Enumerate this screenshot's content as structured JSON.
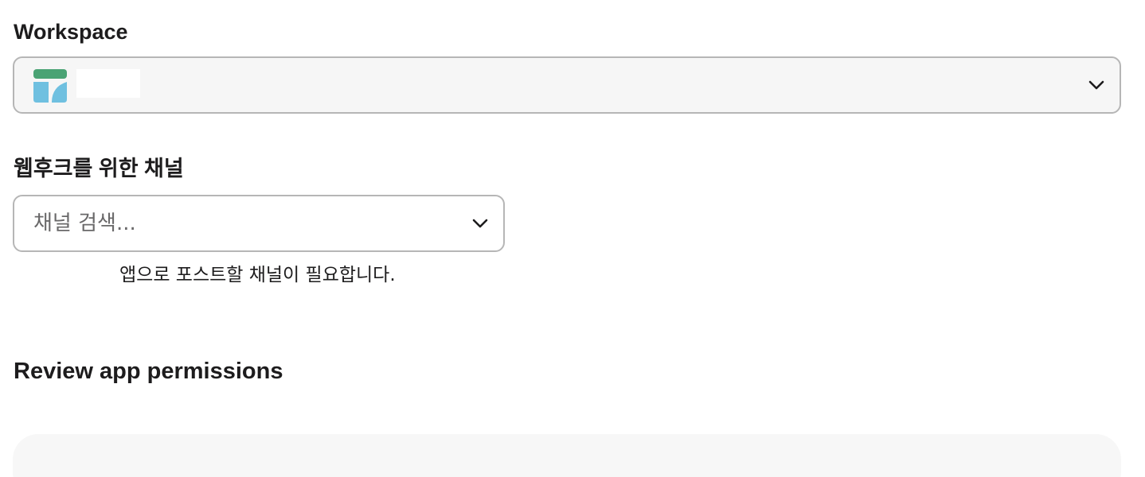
{
  "workspace": {
    "label": "Workspace",
    "selected_name": "",
    "logo_icon": "workspace-logo-icon",
    "dropdown_icon": "chevron-down-icon",
    "colors": {
      "logo_top": "#4aa374",
      "logo_bottom": "#6fc0e0",
      "field_bg": "#f6f6f6"
    }
  },
  "webhook_channel": {
    "label": "웹후크를 위한 채널",
    "placeholder": "채널 검색...",
    "helper_text": "앱으로 포스트할 채널이 필요합니다.",
    "dropdown_icon": "chevron-down-icon"
  },
  "permissions": {
    "heading": "Review app permissions"
  }
}
